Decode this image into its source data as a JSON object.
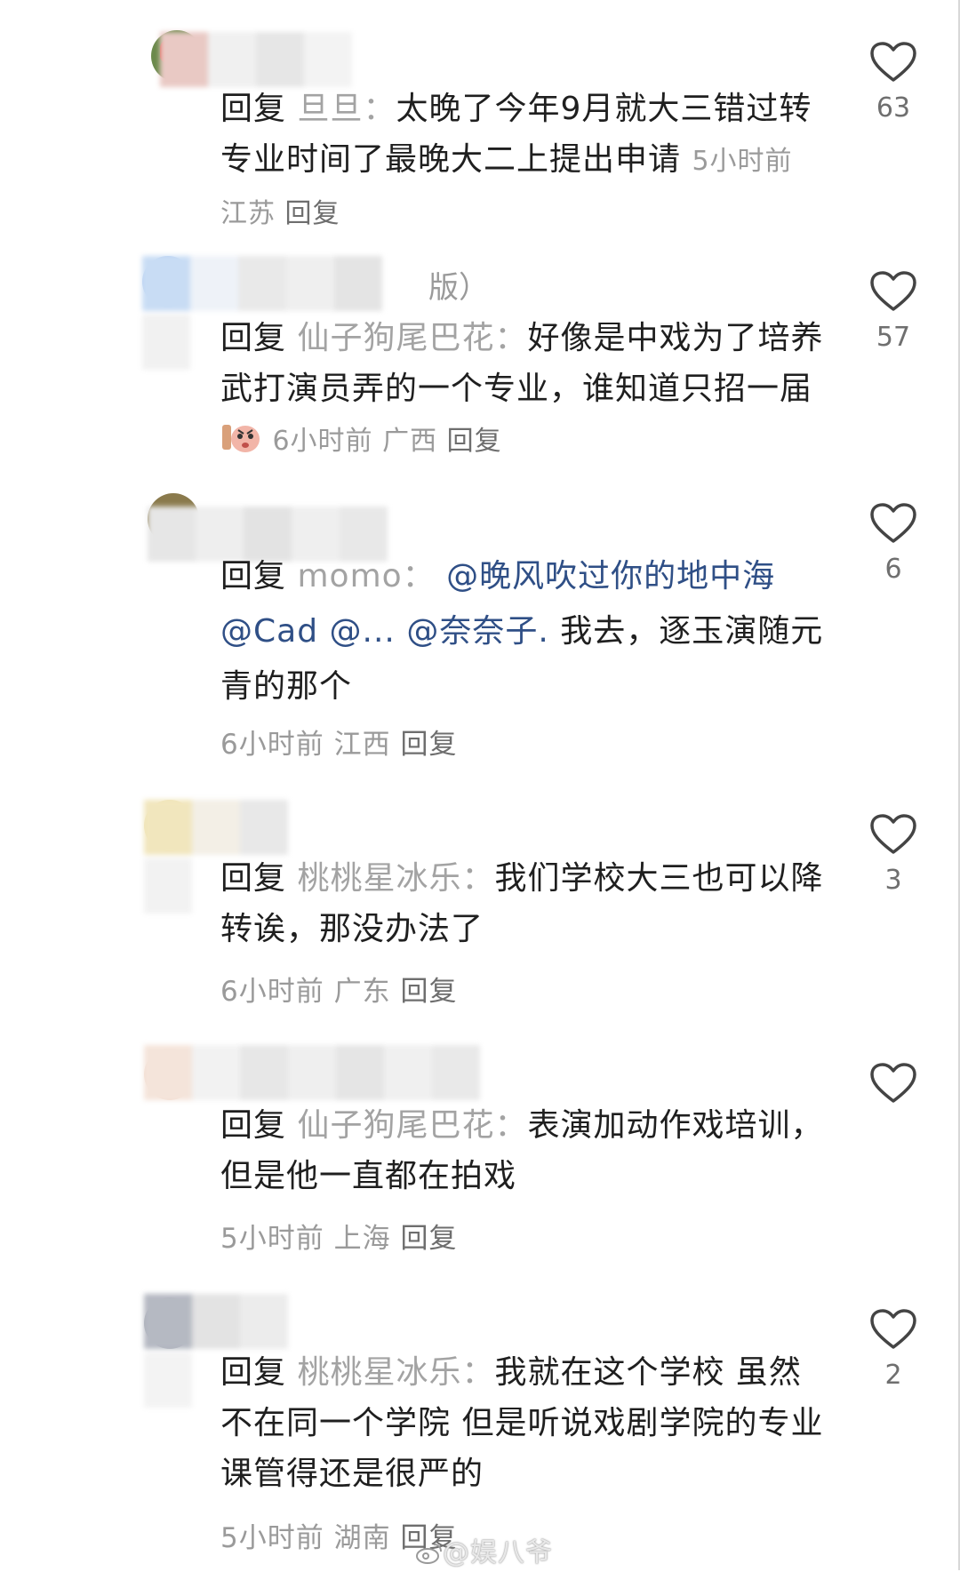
{
  "comments": [
    {
      "name_tail": "",
      "reply_word": "回复",
      "reply_to": "旦旦：",
      "body": "太晚了今年9月就大三错过转专业时间了最晚大二上提出申请",
      "time": "5小时前",
      "location": "江苏",
      "reply_link": "回复",
      "likes": "63"
    },
    {
      "name_tail": "版）",
      "reply_word": "回复",
      "reply_to": "仙子狗尾巴花：",
      "body": "好像是中戏为了培养武打演员弄的一个专业，谁知道只招一届",
      "time": "6小时前",
      "location": "广西",
      "reply_link": "回复",
      "likes": "57"
    },
    {
      "name_tail": "",
      "reply_word": "回复",
      "reply_to": "momo：",
      "mentions": [
        "@晚风吹过你的地中海",
        "@Cad",
        "@...",
        "@奈奈子."
      ],
      "body": "我去，逐玉演随元青的那个",
      "time": "6小时前",
      "location": "江西",
      "reply_link": "回复",
      "likes": "6"
    },
    {
      "name_tail": "",
      "reply_word": "回复",
      "reply_to": "桃桃星冰乐：",
      "body": "我们学校大三也可以降转诶，那没办法了",
      "time": "6小时前",
      "location": "广东",
      "reply_link": "回复",
      "likes": "3"
    },
    {
      "name_tail": "",
      "reply_word": "回复",
      "reply_to": "仙子狗尾巴花：",
      "body": "表演加动作戏培训，但是他一直都在拍戏",
      "time": "5小时前",
      "location": "上海",
      "reply_link": "回复",
      "likes": ""
    },
    {
      "name_tail": "",
      "reply_word": "回复",
      "reply_to": "桃桃星冰乐：",
      "body": "我就在这个学校 虽然不在同一个学院 但是听说戏剧学院的专业课管得还是很严的",
      "time": "5小时前",
      "location": "湖南",
      "reply_link": "回复",
      "likes": "2"
    }
  ],
  "watermark": "@娱八爷",
  "icons": {
    "like": "heart-outline-icon",
    "watermark": "weibo-icon",
    "sticker": "crying-sticker-icon"
  },
  "colors": {
    "mention": "#2f4f86",
    "muted": "#9a9a9a",
    "reply_to": "#a3a3a3"
  }
}
